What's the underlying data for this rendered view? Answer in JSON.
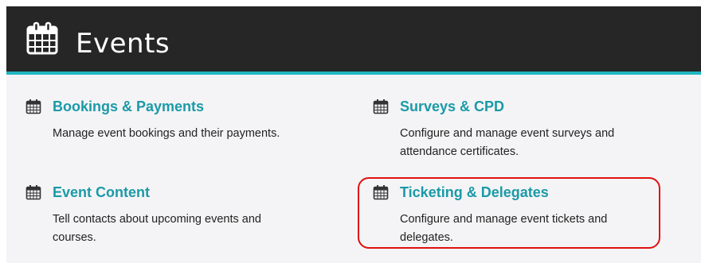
{
  "header": {
    "title": "Events",
    "icon": "calendar-icon"
  },
  "cards": [
    {
      "title": "Bookings & Payments",
      "description": "Manage event bookings and their payments.",
      "icon": "calendar-icon"
    },
    {
      "title": "Surveys & CPD",
      "description": "Configure and manage event surveys and attendance certificates.",
      "icon": "calendar-icon"
    },
    {
      "title": "Event Content",
      "description": "Tell contacts about upcoming events and courses.",
      "icon": "calendar-icon"
    },
    {
      "title": "Ticketing & Delegates",
      "description": "Configure and manage event tickets and delegates.",
      "icon": "calendar-icon"
    }
  ],
  "colors": {
    "header_bg": "#262626",
    "accent": "#1fb6c1",
    "link": "#1a9aa7",
    "highlight": "#e01010",
    "content_bg": "#f4f4f6"
  }
}
